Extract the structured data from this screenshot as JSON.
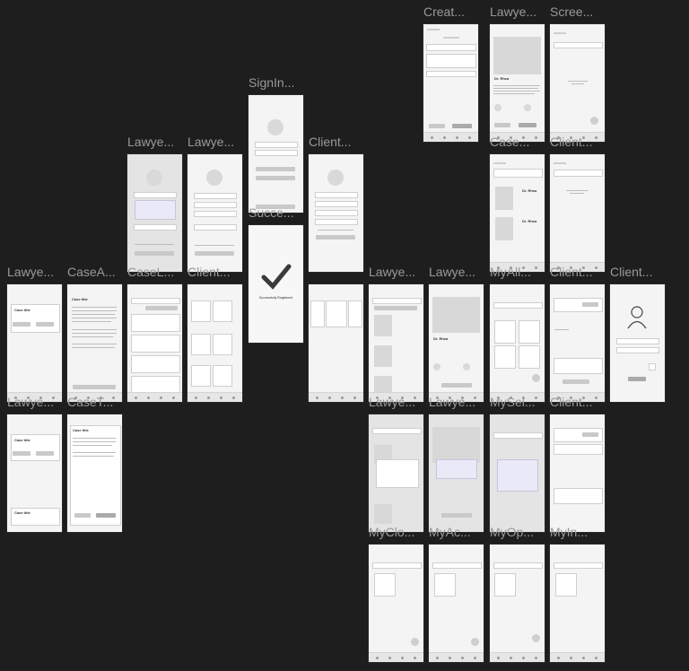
{
  "canvas": {
    "background": "#1e1e1e",
    "label_color": "#9a9a9a",
    "frame_color": "#f4f4f4"
  },
  "frames": [
    {
      "key": "f_create",
      "label": "Creat..."
    },
    {
      "key": "f_lawyer_profile",
      "label": "Lawye..."
    },
    {
      "key": "f_screen",
      "label": "Scree..."
    },
    {
      "key": "f_signin",
      "label": "SignIn..."
    },
    {
      "key": "f_lawyer_a",
      "label": "Lawye..."
    },
    {
      "key": "f_lawyer_b",
      "label": "Lawye..."
    },
    {
      "key": "f_client_signup",
      "label": "Client..."
    },
    {
      "key": "f_case_list",
      "label": "Case..."
    },
    {
      "key": "f_client_top",
      "label": "Client..."
    },
    {
      "key": "f_success",
      "label": "Succe..."
    },
    {
      "key": "f_lawyer_home",
      "label": "Lawye..."
    },
    {
      "key": "f_case_a",
      "label": "CaseA..."
    },
    {
      "key": "f_case_cards",
      "label": "CaseL..."
    },
    {
      "key": "f_client_mid",
      "label": "Client..."
    },
    {
      "key": "f_lawyer_list",
      "label": "Lawye..."
    },
    {
      "key": "f_lawyer_detail",
      "label": "Lawye..."
    },
    {
      "key": "f_myall",
      "label": "MyAll..."
    },
    {
      "key": "f_client_r1",
      "label": "Client..."
    },
    {
      "key": "f_client_r2",
      "label": "Client..."
    },
    {
      "key": "f_lawyer_r3a",
      "label": "Lawye..."
    },
    {
      "key": "f_case_r3b",
      "label": "CaseT..."
    },
    {
      "key": "f_lawyer_r3c",
      "label": "Lawye..."
    },
    {
      "key": "f_lawyer_r3d",
      "label": "Lawye..."
    },
    {
      "key": "f_myse",
      "label": "MySel..."
    },
    {
      "key": "f_client_r3e",
      "label": "Client..."
    },
    {
      "key": "f_mycl",
      "label": "MyClo..."
    },
    {
      "key": "f_myac",
      "label": "MyAc..."
    },
    {
      "key": "f_myop",
      "label": "MyOp..."
    },
    {
      "key": "f_myin",
      "label": "MyIn..."
    }
  ],
  "texts": {
    "success_message": "Successfully Registered",
    "case_title": "Case title",
    "dr_name": "Dr. Rhea"
  }
}
